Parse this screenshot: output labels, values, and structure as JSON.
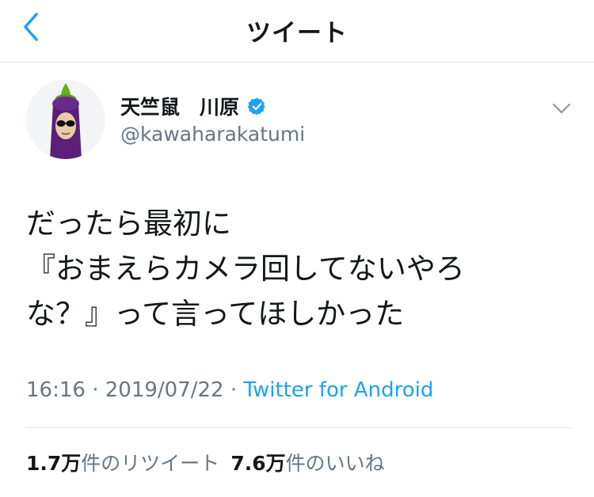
{
  "header": {
    "title": "ツイート",
    "back_icon": "chevron-left-icon",
    "accent_color": "#1da1f2"
  },
  "tweet": {
    "author": {
      "name": "天竺鼠　川原",
      "handle": "@kawaharakatumi",
      "verified": true,
      "avatar_icon": "eggplant-costume-avatar"
    },
    "more_icon": "chevron-down-icon",
    "text_lines": [
      "だったら最初に",
      "『おまえらカメラ回してないやろ",
      "な？』って言ってほしかった"
    ],
    "time": "16:16",
    "date": "2019/07/22",
    "separator": "·",
    "source": "Twitter for Android",
    "retweets": {
      "count": "1.7万",
      "label": "件のリツイート"
    },
    "likes": {
      "count": "7.6万",
      "label": "件のいいね"
    }
  },
  "colors": {
    "text": "#14171a",
    "muted": "#657786",
    "link": "#1da1f2",
    "divider": "#e1e8ed"
  }
}
